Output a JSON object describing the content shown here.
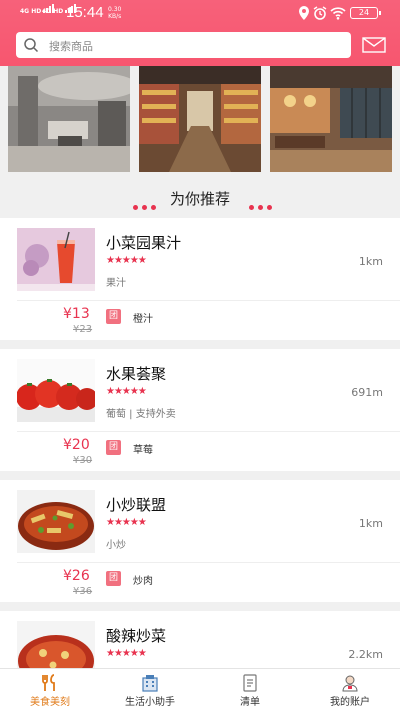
{
  "status": {
    "signal1": "4G HD",
    "signal2": "4G HD",
    "time": "15:44",
    "speed_value": "0.30",
    "speed_unit": "KB/s",
    "battery": "24"
  },
  "search": {
    "placeholder": "搜索商品",
    "icon": "search-icon"
  },
  "header": {
    "mail_icon": "mail-icon"
  },
  "section": {
    "title": "为你推荐"
  },
  "shops": [
    {
      "name": "小菜园果汁",
      "rating": 5,
      "distance": "1km",
      "tags": "果汁",
      "price": "¥13",
      "old_price": "¥23",
      "badge": "团",
      "deal": "橙汁"
    },
    {
      "name": "水果荟聚",
      "rating": 5,
      "distance": "691m",
      "tags": "葡萄 | 支持外卖",
      "price": "¥20",
      "old_price": "¥30",
      "badge": "团",
      "deal": "草莓"
    },
    {
      "name": "小炒联盟",
      "rating": 5,
      "distance": "1km",
      "tags": "小炒",
      "price": "¥26",
      "old_price": "¥36",
      "badge": "团",
      "deal": "炒肉"
    },
    {
      "name": "酸辣炒菜",
      "rating": 5,
      "distance": "2.2km",
      "tags": "",
      "price": "",
      "old_price": "",
      "badge": "",
      "deal": ""
    }
  ],
  "tabs": [
    {
      "label": "美食美刻",
      "icon": "fork-spoon-icon",
      "active": true
    },
    {
      "label": "生活小助手",
      "icon": "building-icon",
      "active": false
    },
    {
      "label": "清单",
      "icon": "list-icon",
      "active": false
    },
    {
      "label": "我的账户",
      "icon": "user-icon",
      "active": false
    }
  ],
  "colors": {
    "brand": "#f7566f",
    "accent": "#e8334f",
    "active_tab": "#e07b1a"
  }
}
